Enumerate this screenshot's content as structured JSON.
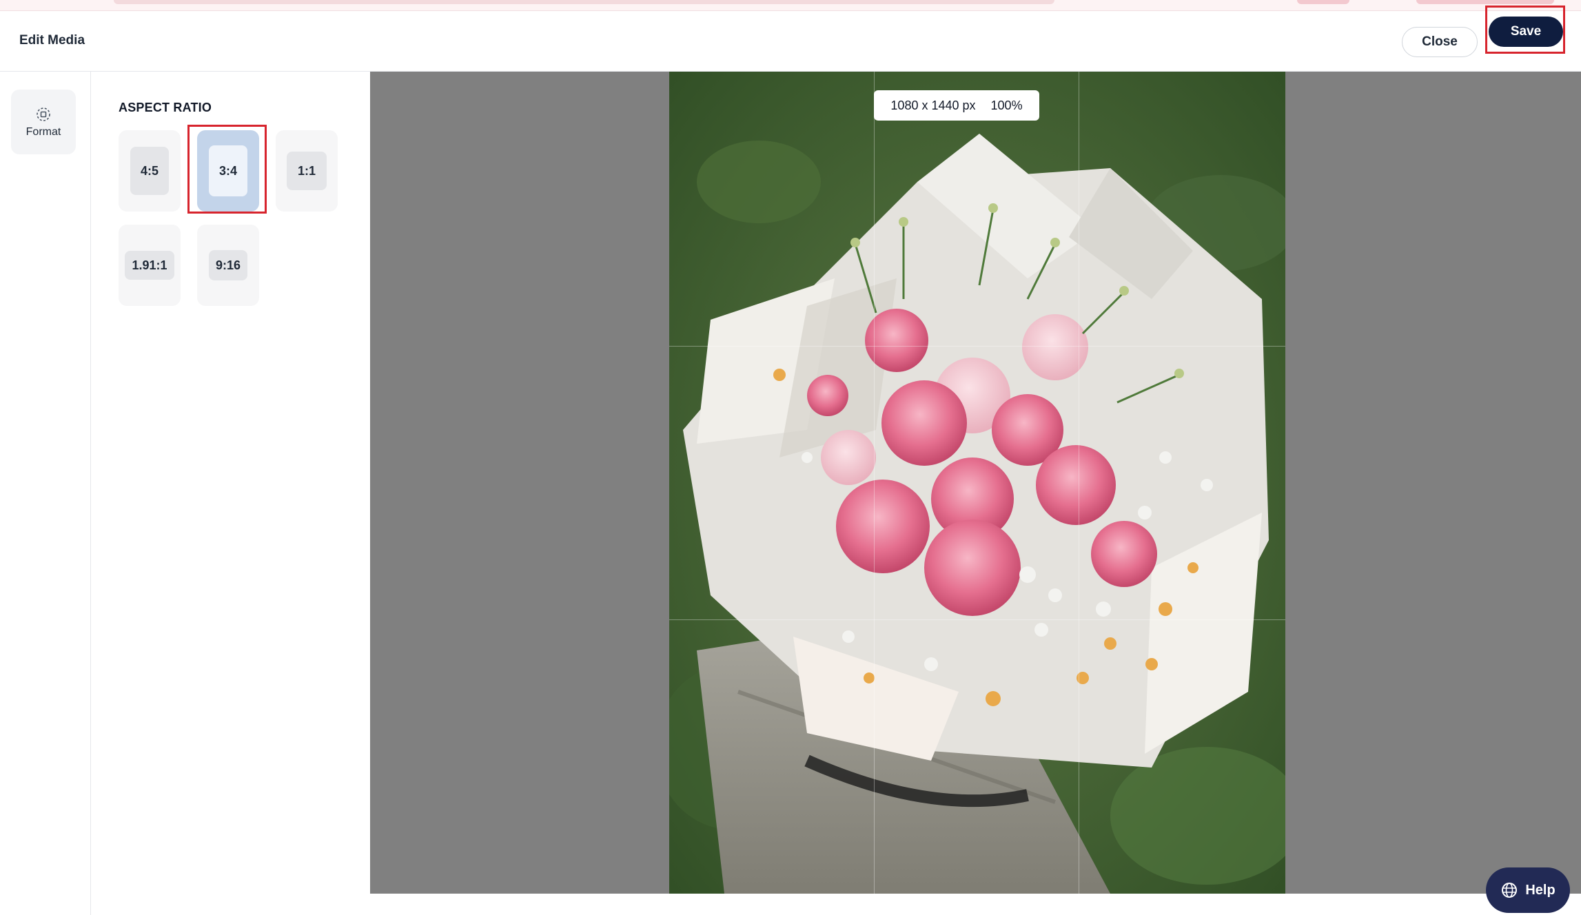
{
  "header": {
    "title": "Edit Media",
    "close_label": "Close",
    "save_label": "Save"
  },
  "rail": {
    "items": [
      {
        "label": "Format",
        "icon": "crop-format-icon"
      }
    ]
  },
  "panel": {
    "heading": "ASPECT RATIO",
    "ratios": [
      {
        "label": "4:5",
        "selected": false
      },
      {
        "label": "3:4",
        "selected": true
      },
      {
        "label": "1:1",
        "selected": false
      },
      {
        "label": "1.91:1",
        "selected": false
      },
      {
        "label": "9:16",
        "selected": false
      }
    ]
  },
  "canvas": {
    "dimensions": "1080 x 1440 px",
    "zoom": "100%",
    "image_subject": "bouquet-photo"
  },
  "help": {
    "label": "Help",
    "icon": "globe-help-icon"
  },
  "colors": {
    "primary": "#0f1d3f",
    "highlight": "#d7242d",
    "selected_ratio": "#c3d4ea",
    "canvas_bg": "#808080",
    "help_bg": "#222a55"
  }
}
